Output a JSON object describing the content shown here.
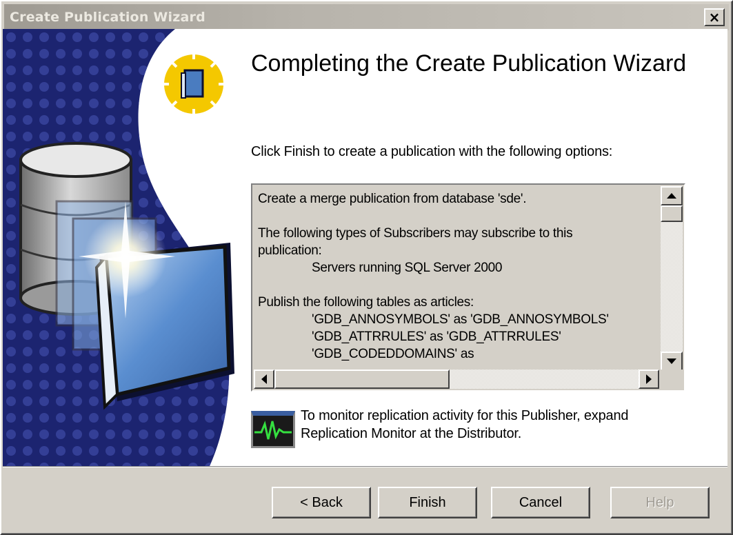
{
  "window": {
    "title": "Create Publication Wizard",
    "close_label": "×"
  },
  "heading": "Completing the Create Publication Wizard",
  "instruction": "Click Finish to create a publication with the following options:",
  "summary": {
    "lines": [
      "Create a merge publication from database 'sde'.",
      "",
      "The following types of Subscribers may subscribe to this",
      "publication:",
      "Servers running SQL Server 2000",
      "",
      "Publish the following tables as articles:",
      "'GDB_ANNOSYMBOLS' as 'GDB_ANNOSYMBOLS'",
      "'GDB_ATTRRULES' as 'GDB_ATTRRULES'",
      "'GDB_CODEDDOMAINS' as"
    ]
  },
  "monitor_note": {
    "line1": "To monitor replication activity for this Publisher, expand",
    "line2": "Replication Monitor at the Distributor."
  },
  "buttons": {
    "back": "< Back",
    "finish": "Finish",
    "cancel": "Cancel",
    "help": "Help"
  },
  "colors": {
    "art_navy": "#1c2470",
    "art_yellow": "#f4c800",
    "book_blue": "#4a7cc0"
  },
  "icons": {
    "wizard_badge": "book-with-sparkle-icon",
    "side_art": "database-and-book-illustration",
    "monitor": "replication-monitor-icon"
  }
}
